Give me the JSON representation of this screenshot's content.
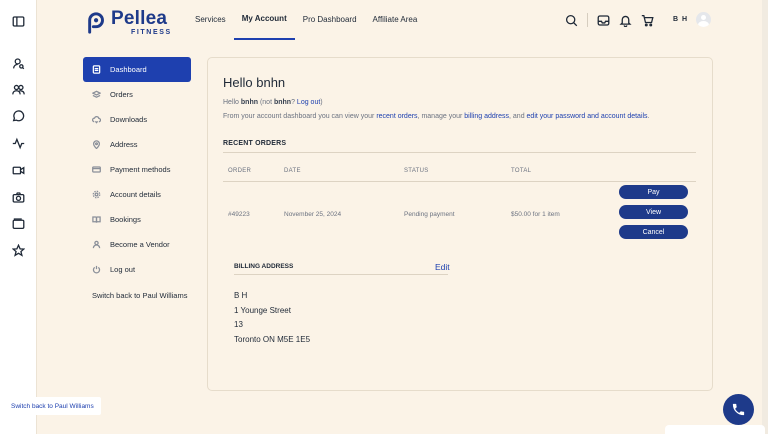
{
  "brand": {
    "name": "Pellea",
    "tagline": "FITNESS"
  },
  "nav": [
    {
      "label": "Services"
    },
    {
      "label": "My Account",
      "active": true
    },
    {
      "label": "Pro Dashboard"
    },
    {
      "label": "Affiliate Area"
    }
  ],
  "user": {
    "initials": "B H"
  },
  "sidebar": {
    "items": [
      {
        "label": "Dashboard",
        "icon": "dashboard-icon",
        "active": true
      },
      {
        "label": "Orders",
        "icon": "layers-icon"
      },
      {
        "label": "Downloads",
        "icon": "cloud-download-icon"
      },
      {
        "label": "Address",
        "icon": "map-pin-icon"
      },
      {
        "label": "Payment methods",
        "icon": "credit-card-icon"
      },
      {
        "label": "Account details",
        "icon": "gear-icon"
      },
      {
        "label": "Bookings",
        "icon": "book-icon"
      },
      {
        "label": "Become a Vendor",
        "icon": "user-icon"
      },
      {
        "label": "Log out",
        "icon": "power-icon"
      }
    ],
    "switch_back": "Switch back to Paul Williams"
  },
  "main": {
    "title": "Hello bnhn",
    "hello": {
      "prefix": "Hello ",
      "user": "bnhn",
      "mid": " (not ",
      "user2": "bnhn",
      "q": "? ",
      "logout": "Log out",
      "end": ")"
    },
    "intro": {
      "t1": "From your account dashboard you can view your ",
      "l1": "recent orders",
      "t2": ", manage your ",
      "l2": "billing address",
      "t3": ", and ",
      "l3": "edit your password and account details",
      "t4": "."
    },
    "recent_orders": {
      "title": "RECENT ORDERS",
      "headers": {
        "order": "ORDER",
        "date": "DATE",
        "status": "STATUS",
        "total": "TOTAL"
      },
      "row": {
        "order": "#49223",
        "date": "November 25, 2024",
        "status": "Pending payment",
        "total": "$50.00 for 1 item",
        "actions": {
          "pay": "Pay",
          "view": "View",
          "cancel": "Cancel"
        }
      }
    },
    "billing": {
      "title": "BILLING ADDRESS",
      "edit": "Edit",
      "lines": [
        "B H",
        "1 Younge Street",
        "13",
        "Toronto ON M5E 1E5"
      ]
    }
  },
  "switch_float": "Switch back to Paul Williams",
  "colors": {
    "accent": "#1e40af",
    "button": "#1e3a8a",
    "background": "#fbf3e7"
  }
}
